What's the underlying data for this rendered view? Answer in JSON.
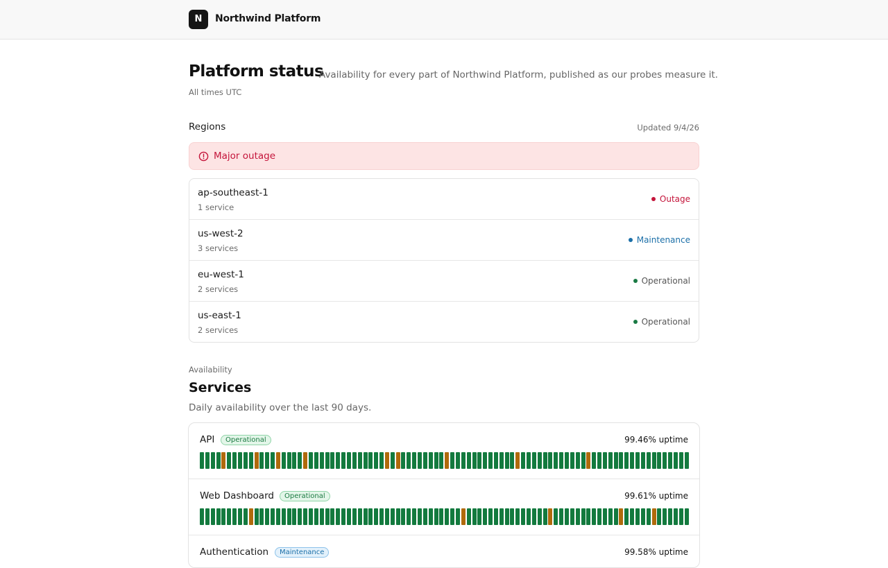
{
  "header": {
    "logo_letter": "N",
    "brand": "Northwind Platform"
  },
  "page": {
    "title": "Platform status",
    "subtitle": "Availability for every part of Northwind Platform, published as our probes measure it.",
    "timezone": "All times UTC"
  },
  "regions": {
    "heading": "Regions",
    "updated": "Updated 9/4/26",
    "banner": {
      "text": "Major outage",
      "icon": "alert-circle-icon",
      "color": "#c4143a"
    },
    "items": [
      {
        "name": "ap-southeast-1",
        "count": "1 service",
        "status": "Outage",
        "color": "#c4143a"
      },
      {
        "name": "us-west-2",
        "count": "3 services",
        "status": "Maintenance",
        "color": "#1b6fa8"
      },
      {
        "name": "eu-west-1",
        "count": "2 services",
        "status": "Operational",
        "color": "#1a7a44"
      },
      {
        "name": "us-east-1",
        "count": "2 services",
        "status": "Operational",
        "color": "#1a7a44"
      }
    ]
  },
  "services": {
    "eyebrow": "Availability",
    "title": "Services",
    "subtitle": "Daily availability over the last 90 days.",
    "colors": {
      "up": "#137a3e",
      "degraded": "#b06a0c"
    },
    "items": [
      {
        "name": "API",
        "badge": "Operational",
        "badge_kind": "operational",
        "uptime": "99.46% uptime",
        "degraded_days": [
          4,
          10,
          14,
          19,
          34,
          36,
          45,
          58,
          71
        ]
      },
      {
        "name": "Web Dashboard",
        "badge": "Operational",
        "badge_kind": "operational",
        "uptime": "99.61% uptime",
        "degraded_days": [
          9,
          48,
          64,
          77,
          83
        ]
      },
      {
        "name": "Authentication",
        "badge": "Maintenance",
        "badge_kind": "maintenance",
        "uptime": "99.58% uptime",
        "degraded_days": []
      }
    ]
  }
}
